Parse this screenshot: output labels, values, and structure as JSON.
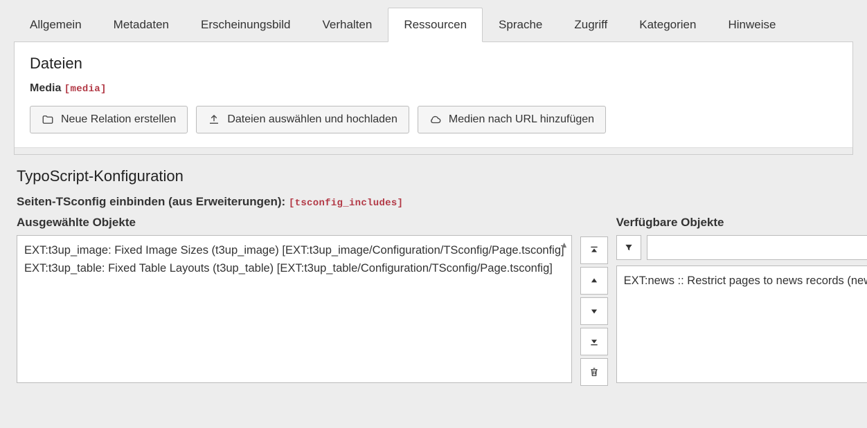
{
  "tabs": {
    "allgemein": "Allgemein",
    "metadaten": "Metadaten",
    "erscheinungsbild": "Erscheinungsbild",
    "verhalten": "Verhalten",
    "ressourcen": "Ressourcen",
    "sprache": "Sprache",
    "zugriff": "Zugriff",
    "kategorien": "Kategorien",
    "hinweise": "Hinweise"
  },
  "files": {
    "heading": "Dateien",
    "media_label": "Media",
    "media_sysname": "[media]",
    "btn_new_relation": "Neue Relation erstellen",
    "btn_select_upload": "Dateien auswählen und hochladen",
    "btn_add_by_url": "Medien nach URL hinzufügen"
  },
  "tsconfig": {
    "heading": "TypoScript-Konfiguration",
    "include_label": "Seiten-TSconfig einbinden (aus Erweiterungen):",
    "include_sysname": "[tsconfig_includes]",
    "selected_label": "Ausgewählte Objekte",
    "available_label": "Verfügbare Objekte",
    "selected_items": [
      "EXT:t3up_image: Fixed Image Sizes (t3up_image) [EXT:t3up_image/Configuration/TSconfig/Page.tsconfig]",
      "EXT:t3up_table: Fixed Table Layouts (t3up_table) [EXT:t3up_table/Configuration/TSconfig/Page.tsconfig]"
    ],
    "available_items": [
      "EXT:news :: Restrict pages to news records (news) [EXT:news/Configuration/TSconfig/Page.tsconfig]"
    ],
    "filter_value": ""
  }
}
